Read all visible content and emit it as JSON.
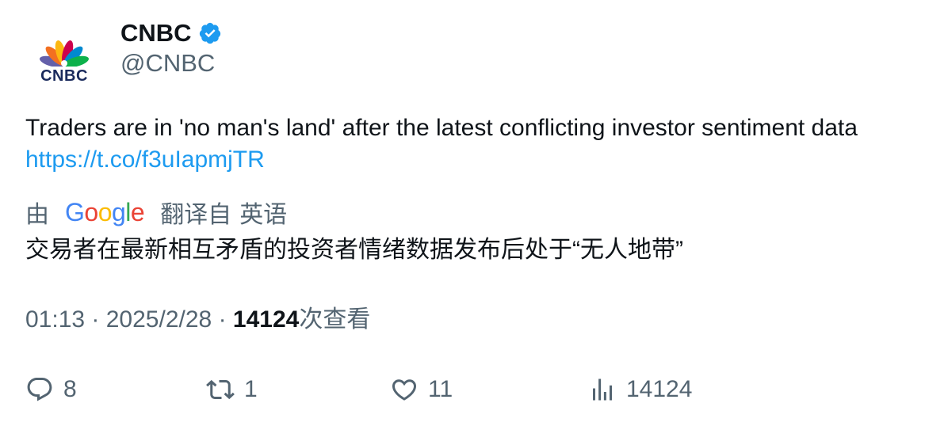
{
  "author": {
    "name": "CNBC",
    "handle": "@CNBC",
    "avatar_logo_text": "CNBC",
    "verified": true,
    "verified_color": "#1d9bf0"
  },
  "tweet": {
    "text": "Traders are in 'no man's land' after the latest conflicting investor sentiment data",
    "link": "https://t.co/f3uIapmjTR",
    "link_color": "#1d9bf0"
  },
  "translation": {
    "by_label": "由",
    "provider": "Google",
    "translated_from": "翻译自",
    "source_language": "英语",
    "text": "交易者在最新相互矛盾的投资者情绪数据发布后处于“无人地带”"
  },
  "meta": {
    "time": "01:13",
    "separator": "·",
    "date": "2025/2/28",
    "views_count": "14124",
    "views_label": "次查看"
  },
  "actions": {
    "reply": {
      "icon": "reply-icon",
      "count": "8"
    },
    "retweet": {
      "icon": "retweet-icon",
      "count": "1"
    },
    "like": {
      "icon": "heart-icon",
      "count": "11"
    },
    "views": {
      "icon": "views-icon",
      "count": "14124"
    }
  },
  "colors": {
    "text": "#0f1419",
    "secondary": "#536471",
    "accent": "#1d9bf0",
    "google_blue": "#4285f4",
    "google_red": "#ea4335",
    "google_yellow": "#fbbc05",
    "google_green": "#34a853"
  }
}
